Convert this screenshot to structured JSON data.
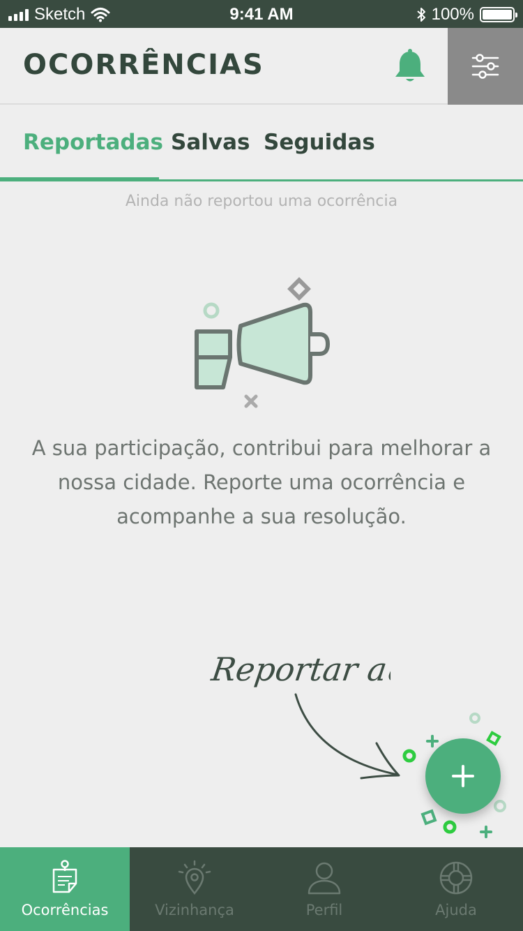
{
  "status_bar": {
    "carrier": "Sketch",
    "time": "9:41 AM",
    "battery": "100%",
    "icons": [
      "signal-icon",
      "wifi-icon",
      "bluetooth-icon",
      "battery-icon"
    ]
  },
  "header": {
    "title": "OCORRÊNCIAS",
    "icons": [
      "bell-icon",
      "filter-sliders-icon"
    ]
  },
  "tabs": [
    {
      "label": "Reportadas",
      "active": true
    },
    {
      "label": "Salvas",
      "active": false
    },
    {
      "label": "Seguidas",
      "active": false
    }
  ],
  "empty_state": {
    "note": "Ainda não reportou uma ocorrência",
    "message": "A sua participação, contribui para melhorar a nossa cidade. Reporte uma ocorrência e acompanhe a sua resolução.",
    "illustration": "megaphone-icon"
  },
  "cta": {
    "hint": "Reportar aqui",
    "fab_icon": "plus-icon"
  },
  "bottom_nav": [
    {
      "label": "Ocorrências",
      "icon": "report-note-icon",
      "active": true
    },
    {
      "label": "Vizinhança",
      "icon": "location-pin-icon",
      "active": false
    },
    {
      "label": "Perfil",
      "icon": "user-icon",
      "active": false
    },
    {
      "label": "Ajuda",
      "icon": "lifebuoy-icon",
      "active": false
    }
  ],
  "colors": {
    "accent": "#4caf7d",
    "dark": "#394b40",
    "background": "#eeeeee",
    "filter_button": "#8a8a8a"
  }
}
